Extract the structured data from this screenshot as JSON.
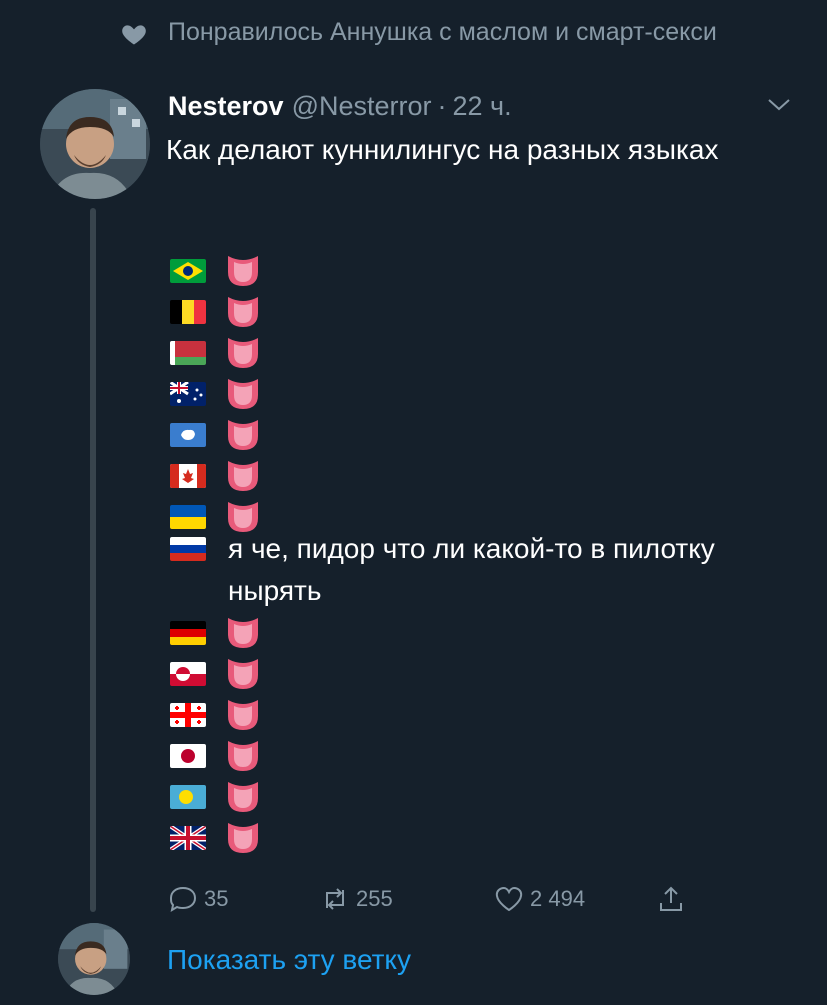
{
  "social_context": {
    "icon": "heart-icon",
    "text": "Понравилось Аннушка с маслом и смарт-секси"
  },
  "tweet": {
    "name": "Nesterov",
    "handle": "@Nesterror",
    "separator": "·",
    "time": "22 ч.",
    "text": "Как делают куннилингус на разных языках",
    "flags": [
      "brazil",
      "belgium",
      "belarus",
      "australia",
      "antarctica",
      "canada",
      "ukraine",
      "russia",
      "germany",
      "greenland",
      "georgia",
      "japan",
      "palau",
      "united-kingdom"
    ],
    "russia_line_text": "я че, пидор что ли какой-то в пилотку нырять",
    "actions": {
      "replies": "35",
      "retweets": "255",
      "likes": "2 494"
    }
  },
  "show_thread": "Показать эту ветку",
  "colors": {
    "background": "#15202b",
    "muted": "#8899a6",
    "accent": "#1da1f2",
    "thread_line": "#38444d"
  }
}
